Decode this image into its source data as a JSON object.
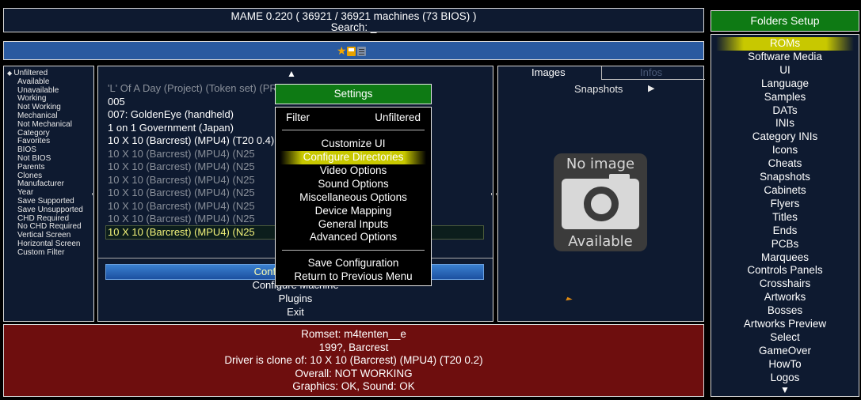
{
  "header": {
    "title": "MAME 0.220 ( 36921 / 36921 machines (73 BIOS) )",
    "search": "Search: _"
  },
  "toolbar": {
    "icons": [
      "star-icon",
      "save-icon",
      "notes-icon"
    ],
    "star_glyph": "★"
  },
  "filters": {
    "items": [
      "Unfiltered",
      "Available",
      "Unavailable",
      "Working",
      "Not Working",
      "Mechanical",
      "Not Mechanical",
      "Category",
      "Favorites",
      "BIOS",
      "Not BIOS",
      "Parents",
      "Clones",
      "Manufacturer",
      "Year",
      "Save Supported",
      "Save Unsupported",
      "CHD Required",
      "No CHD Required",
      "Vertical Screen",
      "Horizontal Screen",
      "Custom Filter"
    ],
    "selected": "Unfiltered"
  },
  "game_list": {
    "items": [
      "'L' Of A Day (Project) (Token set) (PR3008)",
      "005",
      "007: GoldenEye (handheld)",
      "1 on 1 Government (Japan)",
      "10 X 10 (Barcrest) (MPU4) (T20 0.4)",
      "10 X 10 (Barcrest) (MPU4) (N25",
      "10 X 10 (Barcrest) (MPU4) (N25",
      "10 X 10 (Barcrest) (MPU4) (N25",
      "10 X 10 (Barcrest) (MPU4) (N25",
      "10 X 10 (Barcrest) (MPU4) (N25",
      "10 X 10 (Barcrest) (MPU4) (N25",
      "10 X 10 (Barcrest) (MPU4) (N25"
    ]
  },
  "main_menu": {
    "items": [
      "Configure Options",
      "Configure Machine",
      "Plugins",
      "Exit"
    ]
  },
  "image_panel": {
    "tab_images": "Images",
    "tab_infos": "Infos",
    "category": "Snapshots",
    "arrow": "▶",
    "no_image_top": "No image",
    "no_image_bottom": "Available"
  },
  "info": {
    "lines": [
      "Romset: m4tenten__e",
      "199?, Barcrest",
      "Driver is clone of: 10 X 10 (Barcrest) (MPU4) (T20 0.2)",
      "Overall: NOT WORKING",
      "Graphics: OK, Sound: OK"
    ]
  },
  "folders": {
    "title": "Folders Setup",
    "items": [
      "ROMs",
      "Software Media",
      "UI",
      "Language",
      "Samples",
      "DATs",
      "INIs",
      "Category INIs",
      "Icons",
      "Cheats",
      "Snapshots",
      "Cabinets",
      "Flyers",
      "Titles",
      "Ends",
      "PCBs",
      "Marquees",
      "Controls Panels",
      "Crosshairs",
      "Artworks",
      "Bosses",
      "Artworks Preview",
      "Select",
      "GameOver",
      "HowTo",
      "Logos"
    ],
    "selected": "ROMs",
    "more_arrow": "▼"
  },
  "settings": {
    "title": "Settings",
    "filter_label": "Filter",
    "filter_value": "Unfiltered",
    "items": [
      "Customize UI",
      "Configure Directories",
      "Video Options",
      "Sound Options",
      "Miscellaneous Options",
      "Device Mapping",
      "General Inputs",
      "Advanced Options"
    ],
    "selected": "Configure Directories",
    "save": "Save Configuration",
    "back": "Return to Previous Menu"
  },
  "colors": {
    "panel_bg": "#0e1a30",
    "title_green": "#0e7a14",
    "info_red": "#6e0e0e",
    "highlight_yellow": "#c8c800",
    "toolbar_blue": "#2a5aa0"
  }
}
